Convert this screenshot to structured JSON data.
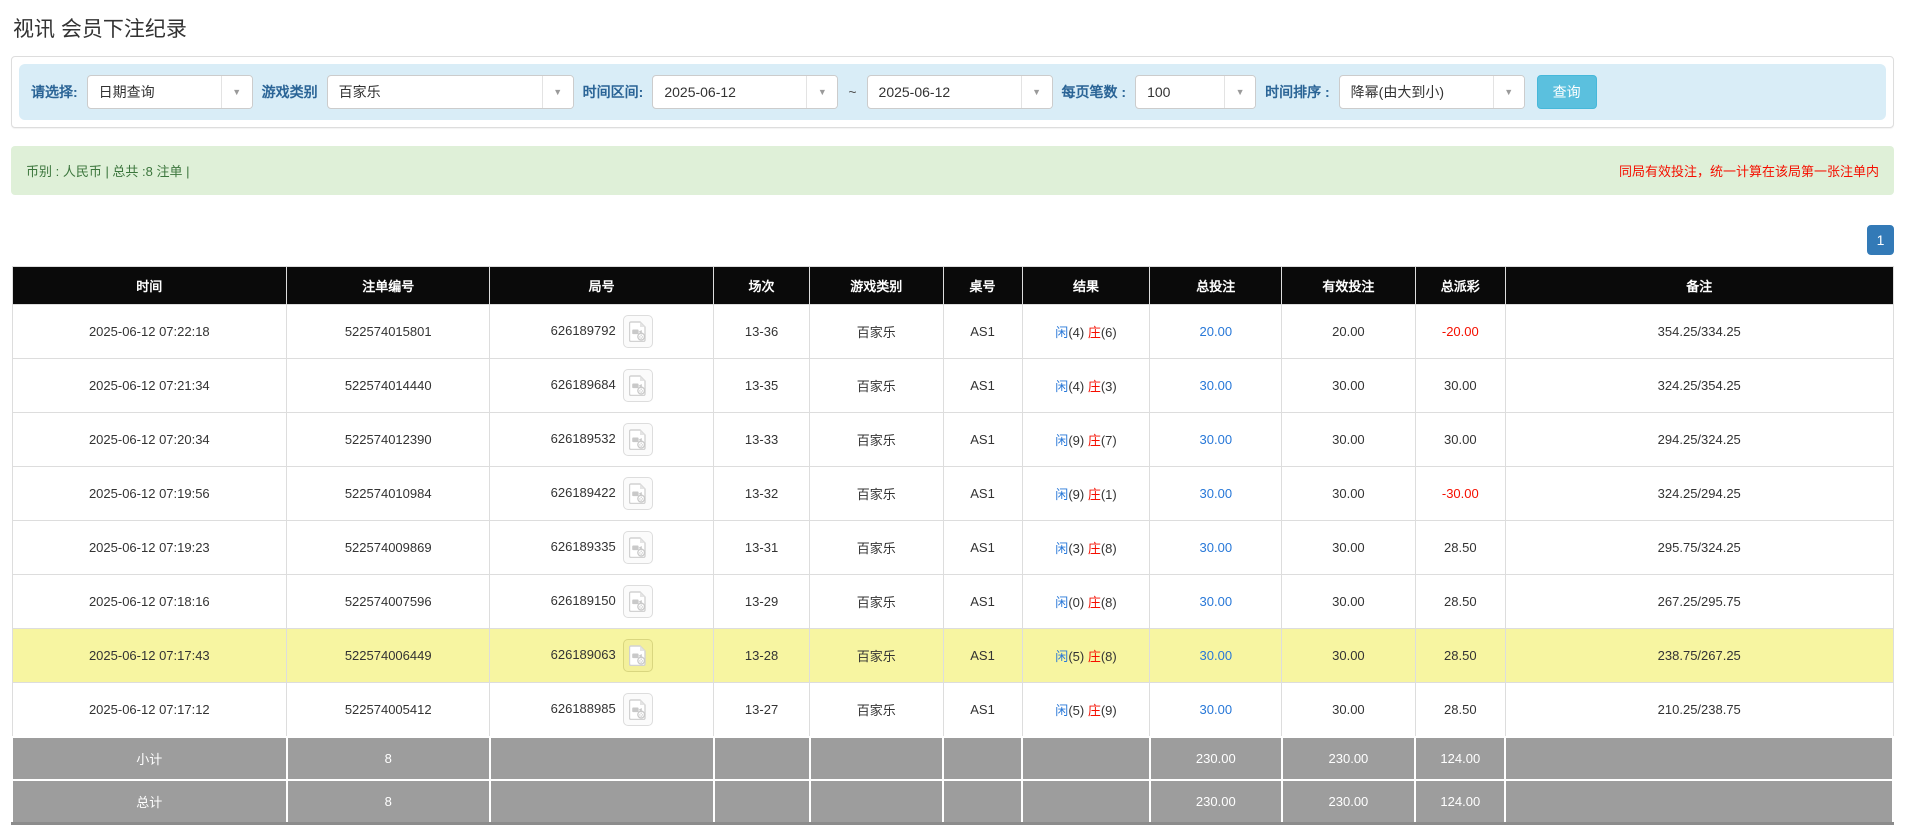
{
  "page": {
    "title": "视讯 会员下注纪录"
  },
  "colors": {
    "filter_bar_bg": "#d9edf7",
    "filter_label_blue": "#2a6496",
    "search_button_bg": "#5bc0de",
    "summary_bar_bg": "#dff0d8",
    "summary_text_green": "#3c763d",
    "notice_red": "#f50f00",
    "pagination_blue": "#337ab7",
    "header_bg": "#0a0a0a",
    "highlight_yellow": "#f7f5a1",
    "summary_row_gray": "#9d9d9d",
    "bet_link_blue": "#2878d8"
  },
  "filters": {
    "select_label": "请选择:",
    "select_value": "日期查询",
    "game_type_label": "游戏类别",
    "game_type_value": "百家乐",
    "date_range_label": "时间区间:",
    "date_from": "2025-06-12",
    "date_separator": "~",
    "date_to": "2025-06-12",
    "page_size_label": "每页笔数 :",
    "page_size_value": "100",
    "sort_label": "时间排序 :",
    "sort_value": "降幂(由大到小)",
    "search_button": "查询",
    "dropdown_arrow": "▼"
  },
  "summary_bar": {
    "left_text": "币别 : 人民币 | 总共 :8 注单 |",
    "right_notice": "同局有效投注，统一计算在该局第一张注单内"
  },
  "pagination": {
    "current_page": "1"
  },
  "table": {
    "headers": [
      "时间",
      "注单编号",
      "局号",
      "场次",
      "游戏类别",
      "桌号",
      "结果",
      "总投注",
      "有效投注",
      "总派彩",
      "备注"
    ],
    "rows": [
      {
        "time": "2025-06-12 07:22:18",
        "bet_id": "522574015801",
        "round_id": "626189792",
        "session": "13-36",
        "game": "百家乐",
        "table_no": "AS1",
        "player_label": "闲",
        "player_score": "(4)",
        "banker_label": "庄",
        "banker_score": "(6)",
        "total_bet": "20.00",
        "valid_bet": "20.00",
        "payout": "-20.00",
        "remark": "354.25/334.25",
        "highlight": false
      },
      {
        "time": "2025-06-12 07:21:34",
        "bet_id": "522574014440",
        "round_id": "626189684",
        "session": "13-35",
        "game": "百家乐",
        "table_no": "AS1",
        "player_label": "闲",
        "player_score": "(4)",
        "banker_label": "庄",
        "banker_score": "(3)",
        "total_bet": "30.00",
        "valid_bet": "30.00",
        "payout": "30.00",
        "remark": "324.25/354.25",
        "highlight": false
      },
      {
        "time": "2025-06-12 07:20:34",
        "bet_id": "522574012390",
        "round_id": "626189532",
        "session": "13-33",
        "game": "百家乐",
        "table_no": "AS1",
        "player_label": "闲",
        "player_score": "(9)",
        "banker_label": "庄",
        "banker_score": "(7)",
        "total_bet": "30.00",
        "valid_bet": "30.00",
        "payout": "30.00",
        "remark": "294.25/324.25",
        "highlight": false
      },
      {
        "time": "2025-06-12 07:19:56",
        "bet_id": "522574010984",
        "round_id": "626189422",
        "session": "13-32",
        "game": "百家乐",
        "table_no": "AS1",
        "player_label": "闲",
        "player_score": "(9)",
        "banker_label": "庄",
        "banker_score": "(1)",
        "total_bet": "30.00",
        "valid_bet": "30.00",
        "payout": "-30.00",
        "remark": "324.25/294.25",
        "highlight": false
      },
      {
        "time": "2025-06-12 07:19:23",
        "bet_id": "522574009869",
        "round_id": "626189335",
        "session": "13-31",
        "game": "百家乐",
        "table_no": "AS1",
        "player_label": "闲",
        "player_score": "(3)",
        "banker_label": "庄",
        "banker_score": "(8)",
        "total_bet": "30.00",
        "valid_bet": "30.00",
        "payout": "28.50",
        "remark": "295.75/324.25",
        "highlight": false
      },
      {
        "time": "2025-06-12 07:18:16",
        "bet_id": "522574007596",
        "round_id": "626189150",
        "session": "13-29",
        "game": "百家乐",
        "table_no": "AS1",
        "player_label": "闲",
        "player_score": "(0)",
        "banker_label": "庄",
        "banker_score": "(8)",
        "total_bet": "30.00",
        "valid_bet": "30.00",
        "payout": "28.50",
        "remark": "267.25/295.75",
        "highlight": false
      },
      {
        "time": "2025-06-12 07:17:43",
        "bet_id": "522574006449",
        "round_id": "626189063",
        "session": "13-28",
        "game": "百家乐",
        "table_no": "AS1",
        "player_label": "闲",
        "player_score": "(5)",
        "banker_label": "庄",
        "banker_score": "(8)",
        "total_bet": "30.00",
        "valid_bet": "30.00",
        "payout": "28.50",
        "remark": "238.75/267.25",
        "highlight": true
      },
      {
        "time": "2025-06-12 07:17:12",
        "bet_id": "522574005412",
        "round_id": "626188985",
        "session": "13-27",
        "game": "百家乐",
        "table_no": "AS1",
        "player_label": "闲",
        "player_score": "(5)",
        "banker_label": "庄",
        "banker_score": "(9)",
        "total_bet": "30.00",
        "valid_bet": "30.00",
        "payout": "28.50",
        "remark": "210.25/238.75",
        "highlight": false
      }
    ],
    "subtotal": {
      "label": "小计",
      "count": "8",
      "total_bet": "230.00",
      "valid_bet": "230.00",
      "payout": "124.00"
    },
    "grand_total": {
      "label": "总计",
      "count": "8",
      "total_bet": "230.00",
      "valid_bet": "230.00",
      "payout": "124.00"
    }
  }
}
